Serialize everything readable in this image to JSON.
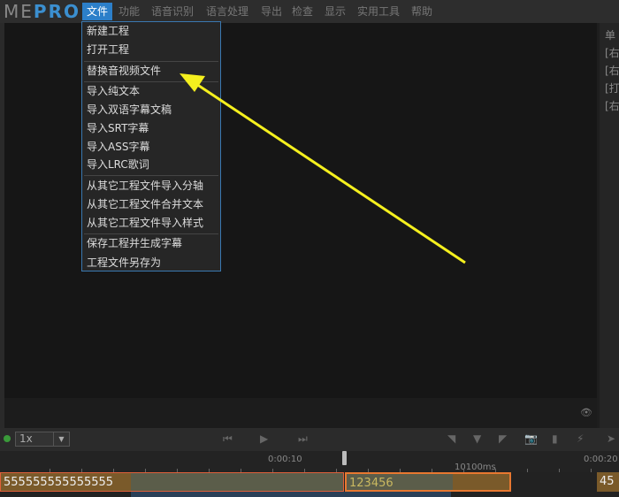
{
  "app": {
    "logo_me": "ME",
    "logo_pro": "PRO"
  },
  "menubar": [
    "文件",
    "功能",
    "语音识别",
    "语言处理",
    "导出",
    "检查",
    "显示",
    "实用工具",
    "帮助"
  ],
  "file_menu": [
    "新建工程",
    "打开工程",
    "替换音视频文件",
    "导入纯文本",
    "导入双语字幕文稿",
    "导入SRT字幕",
    "导入ASS字幕",
    "导入LRC歌词",
    "从其它工程文件导入分轴",
    "从其它工程文件合并文本",
    "从其它工程文件导入样式",
    "保存工程并生成字幕",
    "工程文件另存为"
  ],
  "right_panel": [
    "单",
    "[右",
    "[右",
    "[打",
    "[右"
  ],
  "toolbar": {
    "speed": "1x",
    "icons": [
      "prev-icon",
      "play-icon",
      "next-icon",
      "mark-left-icon",
      "mark-down-icon",
      "mark-right-icon",
      "camera-icon",
      "bookmark-icon",
      "magic-wand-icon",
      "cursor-icon"
    ]
  },
  "timeline": {
    "t1": "0:00:10",
    "t2": "0:00:20",
    "duration_label": "10100ms",
    "segments": [
      "555555555555555",
      "123456",
      "45"
    ]
  },
  "colors": {
    "accent": "#2c7fc9",
    "arrow": "#f5f01e",
    "segment_border": "#e0603a"
  }
}
